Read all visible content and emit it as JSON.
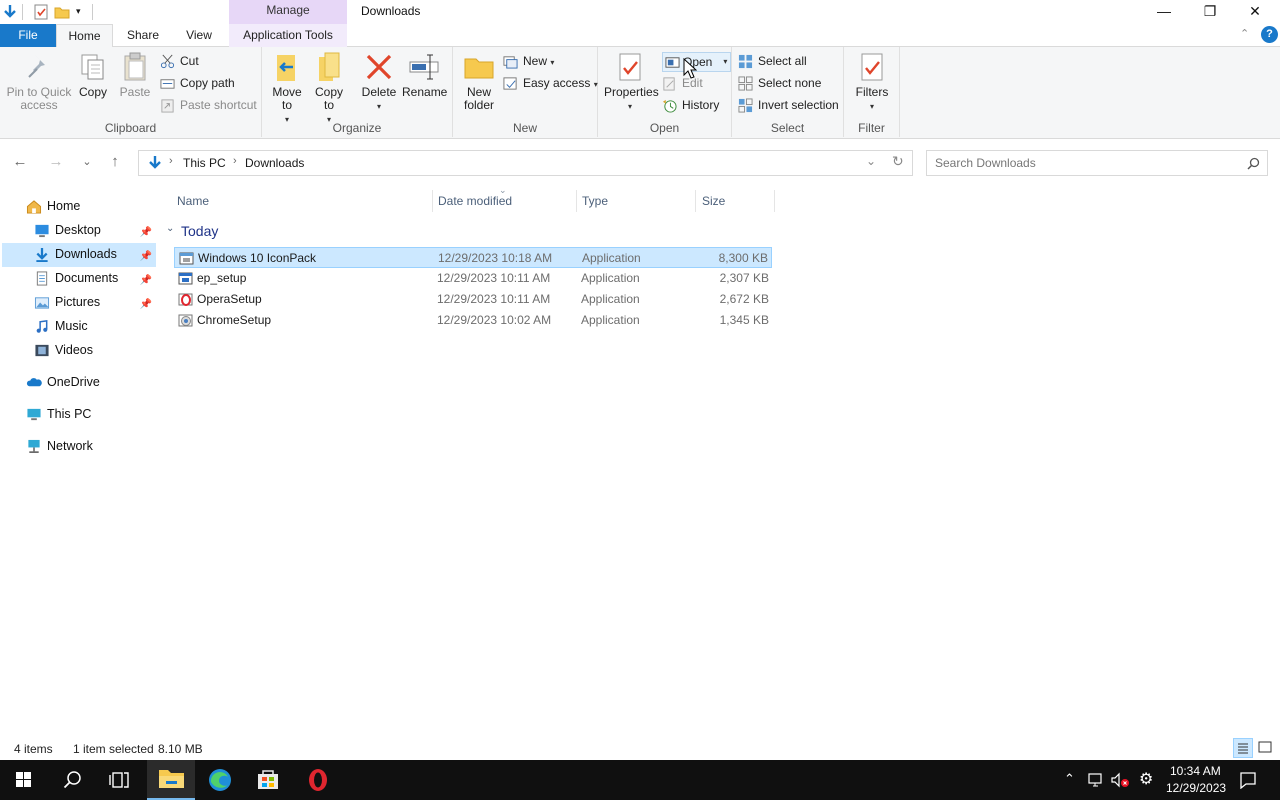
{
  "window": {
    "title": "Downloads",
    "context_tab_group": "Manage",
    "controls": {
      "minimize": "—",
      "maximize": "❐",
      "close": "✕"
    }
  },
  "tabs": {
    "file": "File",
    "home": "Home",
    "share": "Share",
    "view": "View",
    "application_tools": "Application Tools",
    "collapse": "⌃",
    "help": "?"
  },
  "ribbon": {
    "clipboard": {
      "label": "Clipboard",
      "pin": "Pin to Quick access",
      "copy": "Copy",
      "paste": "Paste",
      "cut": "Cut",
      "copy_path": "Copy path",
      "paste_shortcut": "Paste shortcut"
    },
    "organize": {
      "label": "Organize",
      "move_to": "Move to",
      "copy_to": "Copy to",
      "delete": "Delete",
      "rename": "Rename"
    },
    "new": {
      "label": "New",
      "new_folder": "New folder",
      "new_item": "New",
      "easy_access": "Easy access"
    },
    "open": {
      "label": "Open",
      "properties": "Properties",
      "open": "Open",
      "edit": "Edit",
      "history": "History"
    },
    "select": {
      "label": "Select",
      "select_all": "Select all",
      "select_none": "Select none",
      "invert": "Invert selection"
    },
    "filter": {
      "label": "Filter",
      "filters": "Filters"
    }
  },
  "address": {
    "crumbs": [
      "This PC",
      "Downloads"
    ],
    "search_placeholder": "Search Downloads"
  },
  "nav": {
    "items": [
      {
        "label": "Home",
        "pinned": false
      },
      {
        "label": "Desktop",
        "pinned": true
      },
      {
        "label": "Downloads",
        "pinned": true,
        "selected": true
      },
      {
        "label": "Documents",
        "pinned": true
      },
      {
        "label": "Pictures",
        "pinned": true
      },
      {
        "label": "Music",
        "pinned": false
      },
      {
        "label": "Videos",
        "pinned": false
      },
      {
        "label": "OneDrive",
        "pinned": false
      },
      {
        "label": "This PC",
        "pinned": false
      },
      {
        "label": "Network",
        "pinned": false
      }
    ]
  },
  "files": {
    "columns": [
      "Name",
      "Date modified",
      "Type",
      "Size"
    ],
    "group": "Today",
    "rows": [
      {
        "name": "Windows 10 IconPack",
        "date": "12/29/2023 10:18 AM",
        "type": "Application",
        "size": "8,300 KB",
        "selected": true
      },
      {
        "name": "ep_setup",
        "date": "12/29/2023 10:11 AM",
        "type": "Application",
        "size": "2,307 KB",
        "selected": false
      },
      {
        "name": "OperaSetup",
        "date": "12/29/2023 10:11 AM",
        "type": "Application",
        "size": "2,672 KB",
        "selected": false
      },
      {
        "name": "ChromeSetup",
        "date": "12/29/2023 10:02 AM",
        "type": "Application",
        "size": "1,345 KB",
        "selected": false
      }
    ]
  },
  "status": {
    "items": "4 items",
    "selected": "1 item selected",
    "size": "8.10 MB"
  },
  "taskbar": {
    "time": "10:34 AM",
    "date": "12/29/2023"
  },
  "colors": {
    "accent": "#1979ca",
    "selection": "#cce8ff",
    "manage_tab": "#e7d7f7",
    "taskbar": "#101010"
  }
}
